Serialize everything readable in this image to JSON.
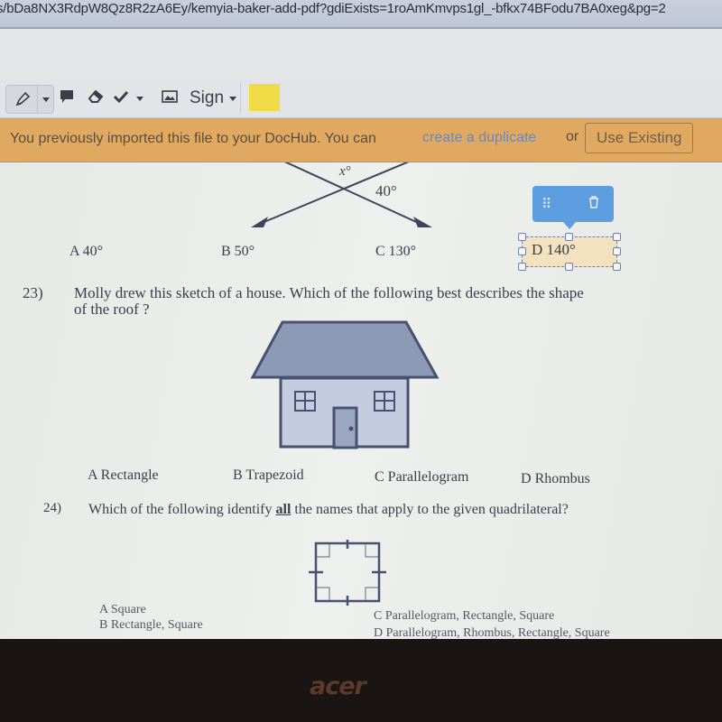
{
  "browser": {
    "url": "s/bDa8NX3RdpW8Qz8R2zA6Ey/kemyia-baker-add-pdf?gdiExists=1roAmKmvps1gl_-bfkx74BFodu7BA0xeg&pg=2"
  },
  "toolbar": {
    "tools": [
      {
        "name": "highlighter",
        "icon": "highlighter-icon"
      },
      {
        "name": "comment",
        "icon": "comment-icon"
      },
      {
        "name": "eraser",
        "icon": "eraser-icon"
      },
      {
        "name": "checkmark",
        "icon": "checkmark-icon"
      },
      {
        "name": "image",
        "icon": "image-icon"
      }
    ],
    "sign_label": "Sign",
    "color_swatch": "#f1dc47"
  },
  "banner": {
    "message": "You previously imported this file to your DocHub. You can",
    "link_label": "create a duplicate",
    "or_label": "or",
    "button_label": "Use Existing"
  },
  "document": {
    "q22": {
      "angle_label_x": "x°",
      "angle_label_given": "40°",
      "options": [
        {
          "letter": "A",
          "text": "40°"
        },
        {
          "letter": "B",
          "text": "50°"
        },
        {
          "letter": "C",
          "text": "130°"
        },
        {
          "letter": "D",
          "text": "140°"
        }
      ],
      "selected_annotation": "D  140°"
    },
    "q23": {
      "number": "23)",
      "line1": "Molly drew this sketch of a house.  Which of the following best describes the shape",
      "line2": "of the roof ?",
      "options": [
        {
          "letter": "A",
          "text": "Rectangle"
        },
        {
          "letter": "B",
          "text": "Trapezoid"
        },
        {
          "letter": "C",
          "text": "Parallelogram"
        },
        {
          "letter": "D",
          "text": "Rhombus"
        }
      ]
    },
    "q24": {
      "number": "24)",
      "text_before": "Which of the following identify ",
      "text_emph": "all",
      "text_after": " the names that apply to the given quadrilateral?",
      "options": [
        {
          "letter": "A",
          "text": "Square"
        },
        {
          "letter": "B",
          "text": "Rectangle, Square"
        },
        {
          "letter": "C",
          "text": "Parallelogram, Rectangle, Square"
        },
        {
          "letter": "D",
          "text": "Parallelogram, Rhombus, Rectangle, Square"
        }
      ]
    }
  },
  "annotation_popover": {
    "drag_icon": "drag-handle-icon",
    "delete_icon": "trash-icon"
  },
  "bezel": {
    "brand": "acer"
  }
}
